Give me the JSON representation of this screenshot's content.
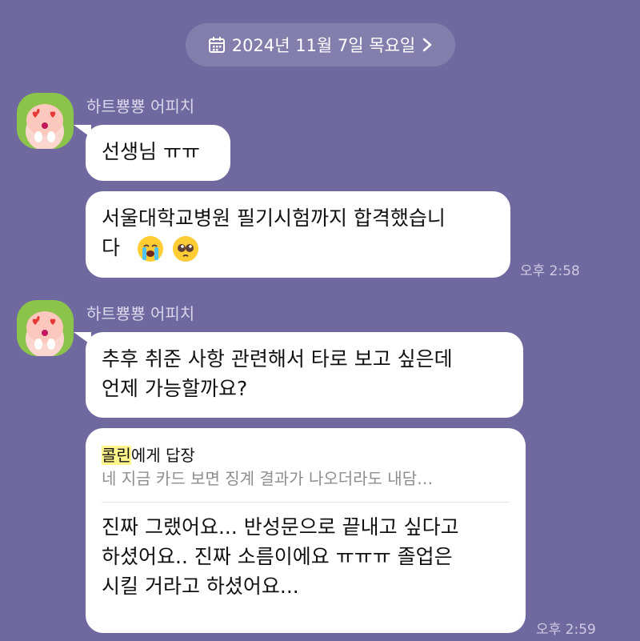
{
  "date_pill": {
    "label": "2024년 11월 7일 목요일"
  },
  "messages": [
    {
      "sender": "하트뿅뿅 어피치",
      "bubble1": "선생님 ㅠㅠ",
      "bubble2_line1": "서울대학교병원 필기시험까지 합격했습니",
      "bubble2_line2": "다",
      "time": "오후 2:58"
    },
    {
      "sender": "하트뿅뿅 어피치",
      "bubble1_line1": "추후 취준 사항 관련해서 타로 보고 싶은데",
      "bubble1_line2": "언제 가능할까요?",
      "reply_name": "콜린",
      "reply_suffix": "에게 답장",
      "reply_preview": "네 지금 카드 보면 징계 결과가 나오더라도 내담…",
      "reply_line1": "진짜 그랬어요... 반성문으로 끝내고 싶다고",
      "reply_line2": "하셨어요.. 진짜 소름이에요 ㅠㅠㅠ 졸업은",
      "reply_line3": "시킬 거라고 하셨어요...",
      "time": "오후 2:59"
    }
  ],
  "icons": [
    "calendar-icon",
    "chevron-right-icon",
    "apeach-avatar",
    "crying-face-emoji",
    "pleading-face-emoji"
  ],
  "colors": {
    "background": "#7069a0",
    "bubble": "#ffffff",
    "avatar_bg": "#8cc34a",
    "highlight": "#fff48a"
  }
}
